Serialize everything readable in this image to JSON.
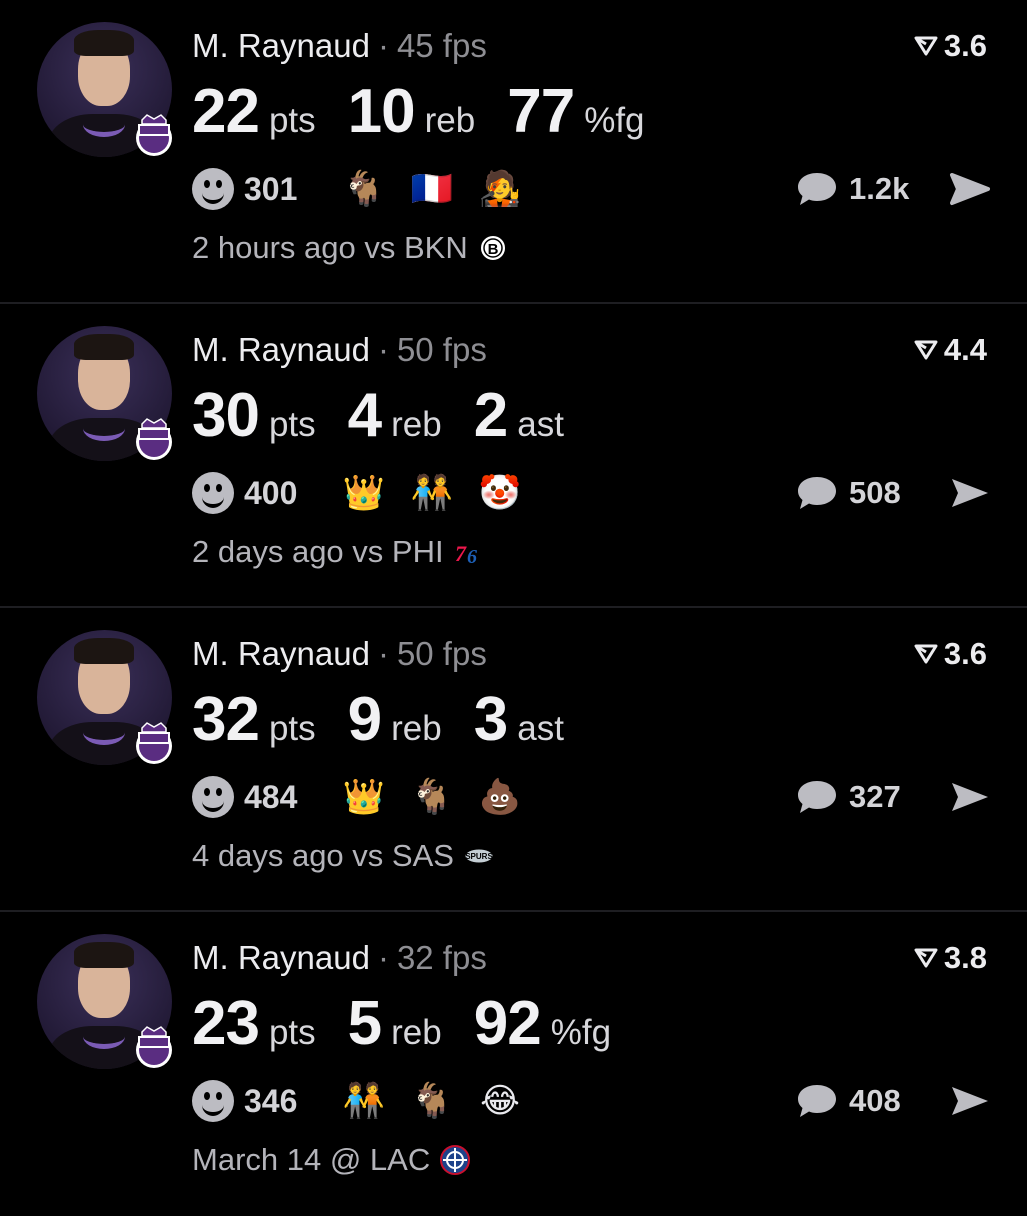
{
  "posts": [
    {
      "player_name": "M. Raynaud",
      "separator": "·",
      "fps": "45 fps",
      "rating": "3.6",
      "stats": [
        {
          "value": "22",
          "unit": "pts"
        },
        {
          "value": "10",
          "unit": "reb"
        },
        {
          "value": "77",
          "unit": "%fg"
        }
      ],
      "reaction_count": "301",
      "emojis": [
        "🐐",
        "🇫🇷",
        "🧑‍🎤"
      ],
      "emoji_names": [
        "goat-emoji",
        "france-flag-emoji",
        "person-emoji"
      ],
      "comment_count": "1.2k",
      "time_ago": "2 hours ago vs BKN",
      "opponent_logo": "nets-logo"
    },
    {
      "player_name": "M. Raynaud",
      "separator": "·",
      "fps": "50 fps",
      "rating": "4.4",
      "stats": [
        {
          "value": "30",
          "unit": "pts"
        },
        {
          "value": "4",
          "unit": "reb"
        },
        {
          "value": "2",
          "unit": "ast"
        }
      ],
      "reaction_count": "400",
      "emojis": [
        "👑",
        "🧑‍🤝‍🧑",
        "🤡"
      ],
      "emoji_names": [
        "crown-emoji",
        "characters-emoji",
        "clown-emoji"
      ],
      "comment_count": "508",
      "time_ago": "2 days ago vs PHI",
      "opponent_logo": "76ers-logo"
    },
    {
      "player_name": "M. Raynaud",
      "separator": "·",
      "fps": "50 fps",
      "rating": "3.6",
      "stats": [
        {
          "value": "32",
          "unit": "pts"
        },
        {
          "value": "9",
          "unit": "reb"
        },
        {
          "value": "3",
          "unit": "ast"
        }
      ],
      "reaction_count": "484",
      "emojis": [
        "👑",
        "🐐",
        "💩"
      ],
      "emoji_names": [
        "crown-emoji",
        "goat-emoji",
        "poop-emoji"
      ],
      "comment_count": "327",
      "time_ago": "4 days ago vs SAS",
      "opponent_logo": "spurs-logo"
    },
    {
      "player_name": "M. Raynaud",
      "separator": "·",
      "fps": "32 fps",
      "rating": "3.8",
      "stats": [
        {
          "value": "23",
          "unit": "pts"
        },
        {
          "value": "5",
          "unit": "reb"
        },
        {
          "value": "92",
          "unit": "%fg"
        }
      ],
      "reaction_count": "346",
      "emojis": [
        "🧑‍🤝‍🧑",
        "🐐",
        "😂"
      ],
      "emoji_names": [
        "characters-emoji",
        "goat-emoji",
        "tears-of-joy-emoji"
      ],
      "comment_count": "408",
      "time_ago": "March 14 @ LAC",
      "opponent_logo": "clippers-logo"
    }
  ],
  "colors": {
    "background": "#000000",
    "primary_text": "#ececef",
    "secondary_text": "#8e8e93",
    "kings_purple": "#5a2d81",
    "divider": "#1e1e22"
  }
}
